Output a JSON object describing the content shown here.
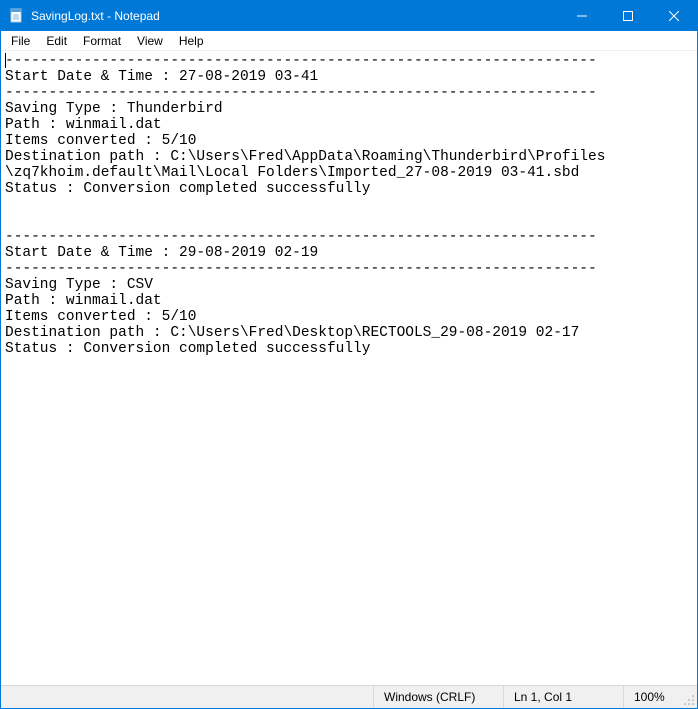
{
  "window": {
    "title": "SavingLog.txt - Notepad"
  },
  "menu": {
    "file": "File",
    "edit": "Edit",
    "format": "Format",
    "view": "View",
    "help": "Help"
  },
  "content": "--------------------------------------------------------------------\nStart Date & Time : 27-08-2019 03-41\n--------------------------------------------------------------------\nSaving Type : Thunderbird\nPath : winmail.dat\nItems converted : 5/10\nDestination path : C:\\Users\\Fred\\AppData\\Roaming\\Thunderbird\\Profiles\n\\zq7khoim.default\\Mail\\Local Folders\\Imported_27-08-2019 03-41.sbd\nStatus : Conversion completed successfully\n\n\n--------------------------------------------------------------------\nStart Date & Time : 29-08-2019 02-19\n--------------------------------------------------------------------\nSaving Type : CSV\nPath : winmail.dat\nItems converted : 5/10\nDestination path : C:\\Users\\Fred\\Desktop\\RECTOOLS_29-08-2019 02-17\nStatus : Conversion completed successfully\n",
  "status": {
    "encoding": "Windows (CRLF)",
    "position": "Ln 1, Col 1",
    "zoom": "100%"
  }
}
